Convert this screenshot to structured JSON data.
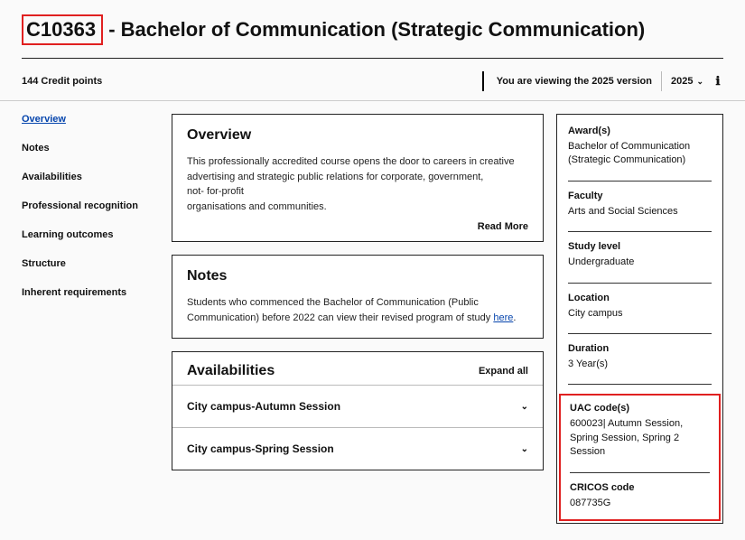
{
  "title": {
    "code": "C10363",
    "name": " - Bachelor of Communication (Strategic Communication)"
  },
  "credit_points": "144 Credit points",
  "version_bar": {
    "viewing": "You are viewing the 2025 version",
    "year": "2025"
  },
  "nav": {
    "items": [
      "Overview",
      "Notes",
      "Availabilities",
      "Professional recognition",
      "Learning outcomes",
      "Structure",
      "Inherent requirements"
    ]
  },
  "overview": {
    "heading": "Overview",
    "p1": "This professionally accredited course opens the door to careers in creative advertising and strategic public relations for corporate, government,",
    "p2": "not- for-profit",
    "p3": "organisations and communities.",
    "read_more": "Read More"
  },
  "notes": {
    "heading": "Notes",
    "text_a": "Students who commenced the Bachelor of Communication (Public Communication) before 2022 can view their revised program of study ",
    "link": "here",
    "text_b": "."
  },
  "availabilities": {
    "heading": "Availabilities",
    "expand_all": "Expand all",
    "items": [
      "City campus-Autumn Session",
      "City campus-Spring Session"
    ]
  },
  "info": {
    "award_label": "Award(s)",
    "award_val": "Bachelor of Communication (Strategic Communication)",
    "faculty_label": "Faculty",
    "faculty_val": "Arts and Social Sciences",
    "level_label": "Study level",
    "level_val": "Undergraduate",
    "location_label": "Location",
    "location_val": "City campus",
    "duration_label": "Duration",
    "duration_val": "3 Year(s)",
    "uac_label": "UAC code(s)",
    "uac_val": "600023| Autumn Session, Spring Session, Spring 2 Session",
    "cricos_label": "CRICOS code",
    "cricos_val": "087735G"
  }
}
